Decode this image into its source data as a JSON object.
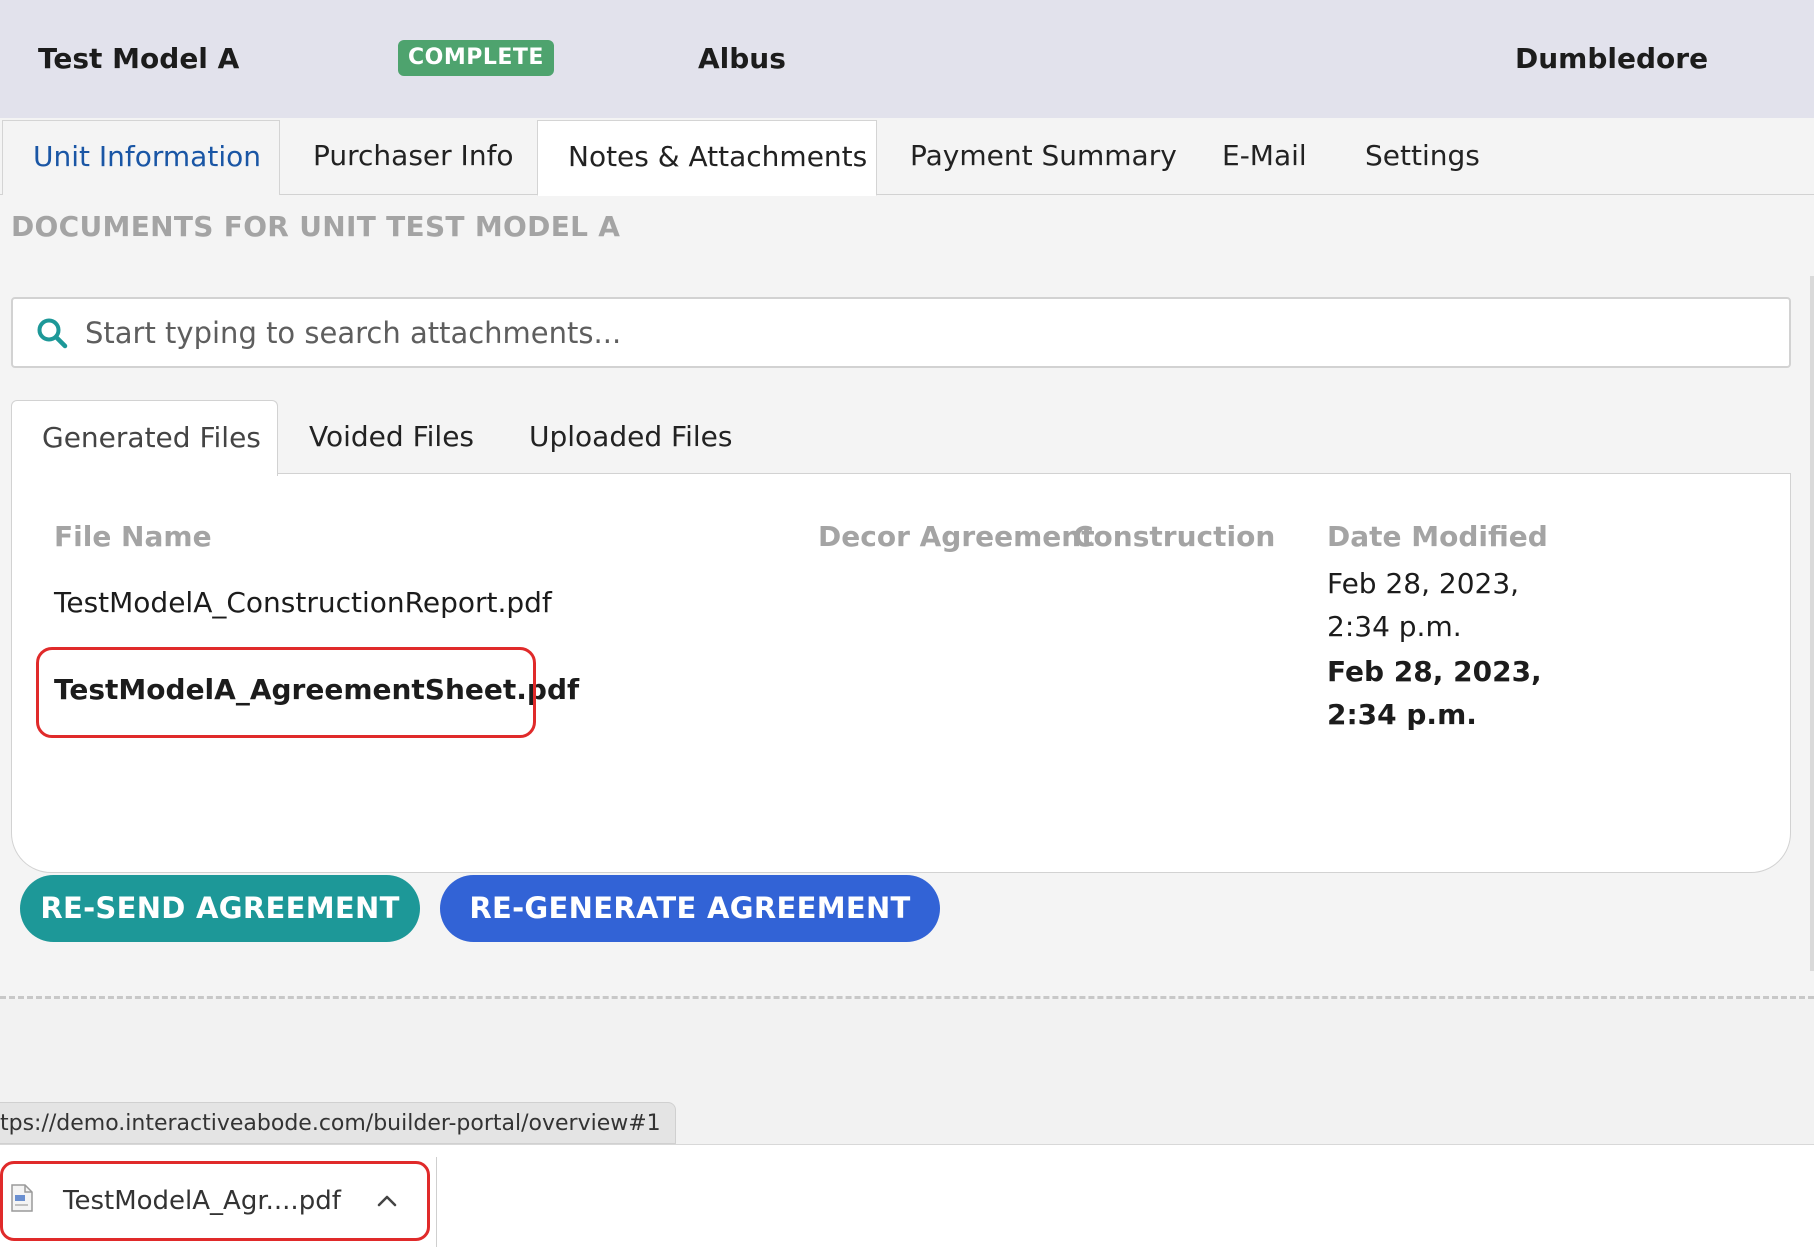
{
  "header": {
    "model": "Test Model A",
    "status_badge": "COMPLETE",
    "first_name": "Albus",
    "last_name": "Dumbledore"
  },
  "main_tabs": [
    {
      "label": "Unit Information"
    },
    {
      "label": "Purchaser Info"
    },
    {
      "label": "Notes & Attachments",
      "active": true
    },
    {
      "label": "Payment Summary"
    },
    {
      "label": "E-Mail"
    },
    {
      "label": "Settings"
    }
  ],
  "documents_title": "DOCUMENTS FOR UNIT TEST MODEL A",
  "search": {
    "placeholder": "Start typing to search attachments...",
    "icon": "search-icon"
  },
  "sub_tabs": [
    {
      "label": "Generated Files",
      "active": true
    },
    {
      "label": "Voided Files"
    },
    {
      "label": "Uploaded Files"
    }
  ],
  "table": {
    "columns": [
      "File Name",
      "Decor Agreement",
      "Construction",
      "Date Modified"
    ],
    "rows": [
      {
        "file_name": "TestModelA_ConstructionReport.pdf",
        "date_modified": "Feb 28, 2023, 2:34 p.m."
      },
      {
        "file_name": "TestModelA_AgreementSheet.pdf",
        "date_modified": "Feb 28, 2023, 2:34 p.m."
      }
    ]
  },
  "buttons": {
    "resend": "RE-SEND AGREEMENT",
    "regenerate": "RE-GENERATE AGREEMENT"
  },
  "status_url": "tps://demo.interactiveabode.com/builder-portal/overview#1",
  "download": {
    "file_name": "TestModelA_Agr....pdf"
  },
  "colors": {
    "badge": "#4ea36e",
    "link_blue": "#1a56a5",
    "resend_button": "#1d9898",
    "regenerate_button": "#3263d6",
    "highlight_red": "#e02a2a"
  }
}
